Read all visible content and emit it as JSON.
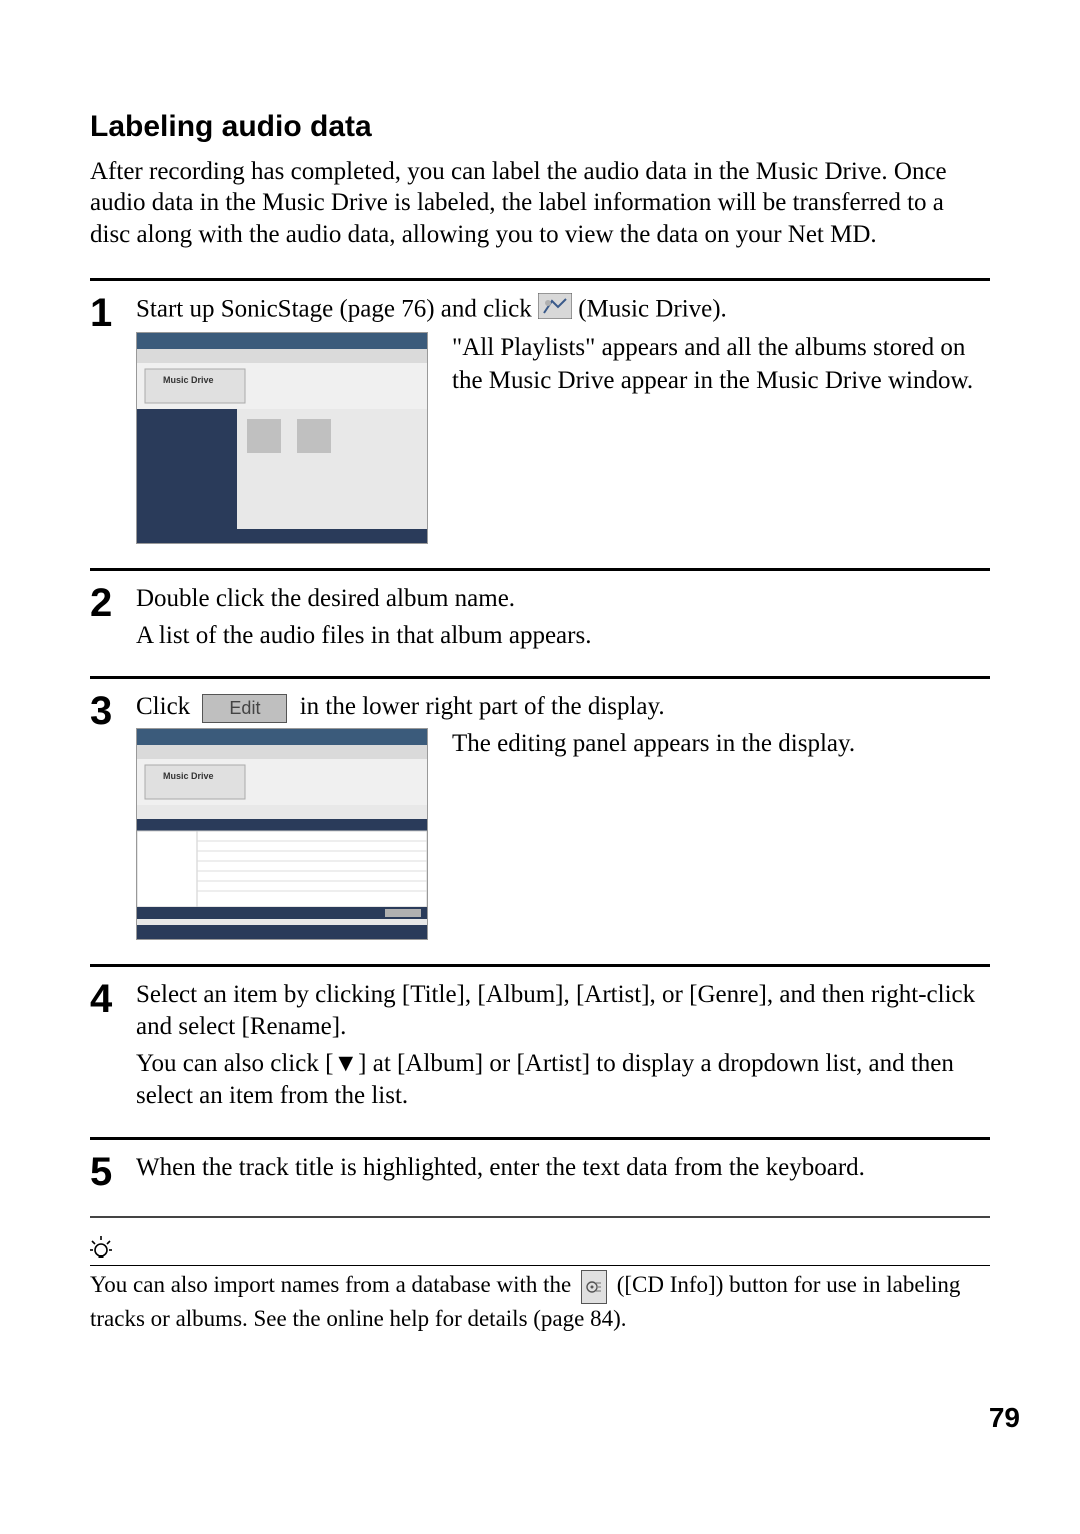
{
  "title": "Labeling audio data",
  "intro": "After recording has completed, you can label the audio data in the Music Drive. Once audio data in the Music Drive is labeled, the label information will be transferred to a disc along with the audio data, allowing you to view the data on your Net MD.",
  "steps": {
    "s1": {
      "num": "1",
      "line_a": "Start up SonicStage (page 76) and click ",
      "line_b": " (Music Drive).",
      "result": "\"All Playlists\" appears and all the albums stored on the Music Drive appear in the Music Drive window."
    },
    "s2": {
      "num": "2",
      "line": "Double click the desired album name.",
      "result": "A list of the audio files in that album appears."
    },
    "s3": {
      "num": "3",
      "line_a": "Click ",
      "edit_label": "Edit",
      "line_b": " in the lower right part of the display.",
      "result": "The editing panel appears in the display."
    },
    "s4": {
      "num": "4",
      "line": "Select an item by clicking [Title], [Album], [Artist], or [Genre], and then right-click and select [Rename].",
      "result": "You can also click [▼] at [Album] or [Artist] to display a dropdown list, and then select an item from the list."
    },
    "s5": {
      "num": "5",
      "line": "When the track title is highlighted, enter the text data from the keyboard."
    }
  },
  "tip": {
    "text_a": "You can also import names from a database with the ",
    "text_b": " ([CD Info]) button for use in labeling tracks or albums. See the online help for details (page 84)."
  },
  "page_number": "79"
}
